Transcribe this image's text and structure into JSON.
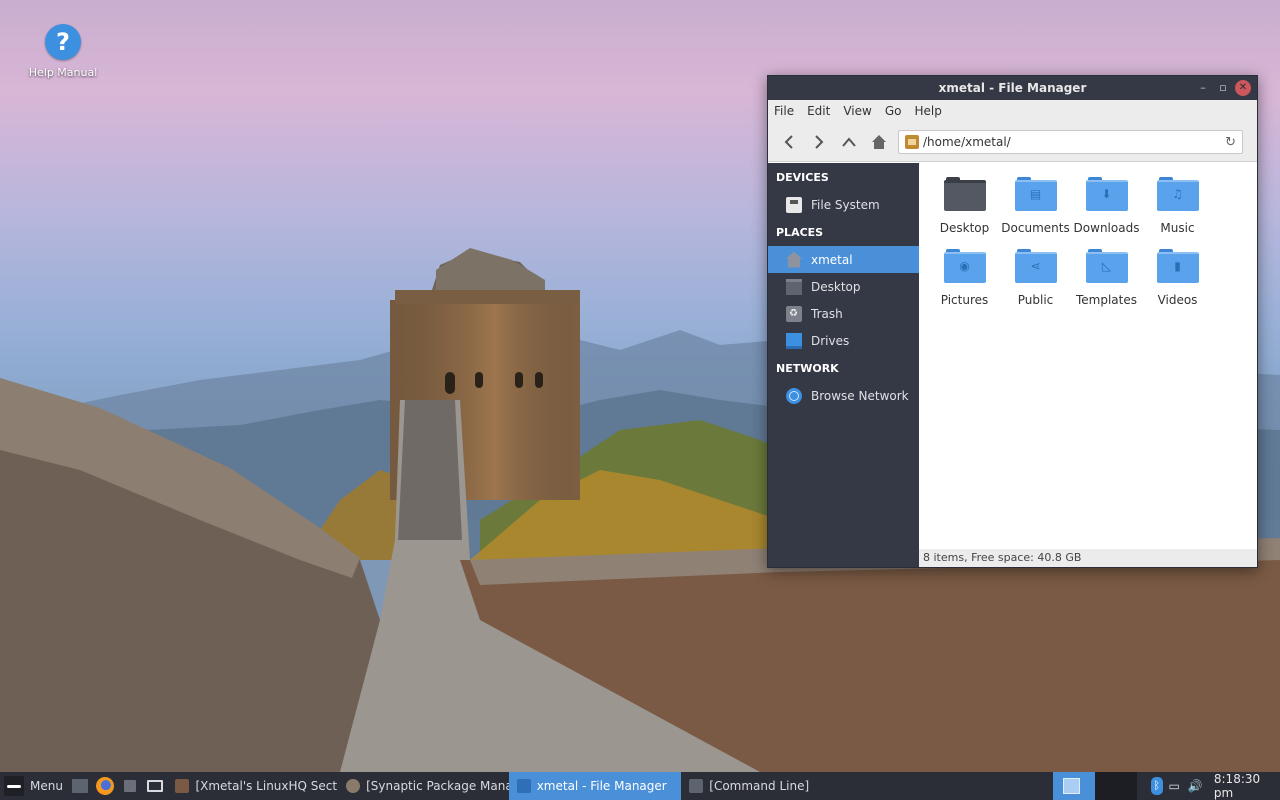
{
  "desktop": {
    "icons": [
      {
        "label": "Help Manual",
        "glyph": "?",
        "icon": "help-icon"
      }
    ]
  },
  "file_manager": {
    "title": "xmetal - File Manager",
    "window_controls": {
      "minimize": "–",
      "maximize": "▫",
      "close": "✕"
    },
    "menu": [
      "File",
      "Edit",
      "View",
      "Go",
      "Help"
    ],
    "toolbar": {
      "path": "/home/xmetal/",
      "buttons": [
        "back-icon",
        "forward-icon",
        "up-icon",
        "home-icon"
      ],
      "reload_glyph": "↻"
    },
    "sidebar": {
      "sections": [
        {
          "title": "DEVICES",
          "items": [
            {
              "label": "File System",
              "icon": "drive-icon"
            }
          ]
        },
        {
          "title": "PLACES",
          "items": [
            {
              "label": "xmetal",
              "icon": "home-icon",
              "active": true
            },
            {
              "label": "Desktop",
              "icon": "desktop-icon"
            },
            {
              "label": "Trash",
              "icon": "trash-icon"
            },
            {
              "label": "Drives",
              "icon": "drives-icon"
            }
          ]
        },
        {
          "title": "NETWORK",
          "items": [
            {
              "label": "Browse Network",
              "icon": "network-icon"
            }
          ]
        }
      ]
    },
    "files": [
      {
        "label": "Desktop",
        "glyph": ""
      },
      {
        "label": "Documents",
        "glyph": "▤"
      },
      {
        "label": "Downloads",
        "glyph": "⬇"
      },
      {
        "label": "Music",
        "glyph": "♫"
      },
      {
        "label": "Pictures",
        "glyph": "◉"
      },
      {
        "label": "Public",
        "glyph": "⋖"
      },
      {
        "label": "Templates",
        "glyph": "◺"
      },
      {
        "label": "Videos",
        "glyph": "▮"
      }
    ],
    "status": "8 items, Free space: 40.8 GB"
  },
  "taskbar": {
    "menu_label": "Menu",
    "tasks": [
      {
        "label": "[Xmetal's LinuxHQ Section ...",
        "active": false
      },
      {
        "label": "[Synaptic Package Manager ]",
        "active": false
      },
      {
        "label": "xmetal - File Manager",
        "active": true
      },
      {
        "label": "[Command Line]",
        "active": false
      }
    ],
    "clock": "8:18:30 pm",
    "bt_glyph": "ᛒ",
    "tray_icons": [
      "monitor-icon",
      "volume-icon"
    ],
    "tray_glyphs": [
      "▭",
      "🔊"
    ]
  },
  "colors": {
    "accent": "#4a90d9",
    "sidebar_bg": "#353945",
    "folder_blue": "#5aa2ec"
  }
}
